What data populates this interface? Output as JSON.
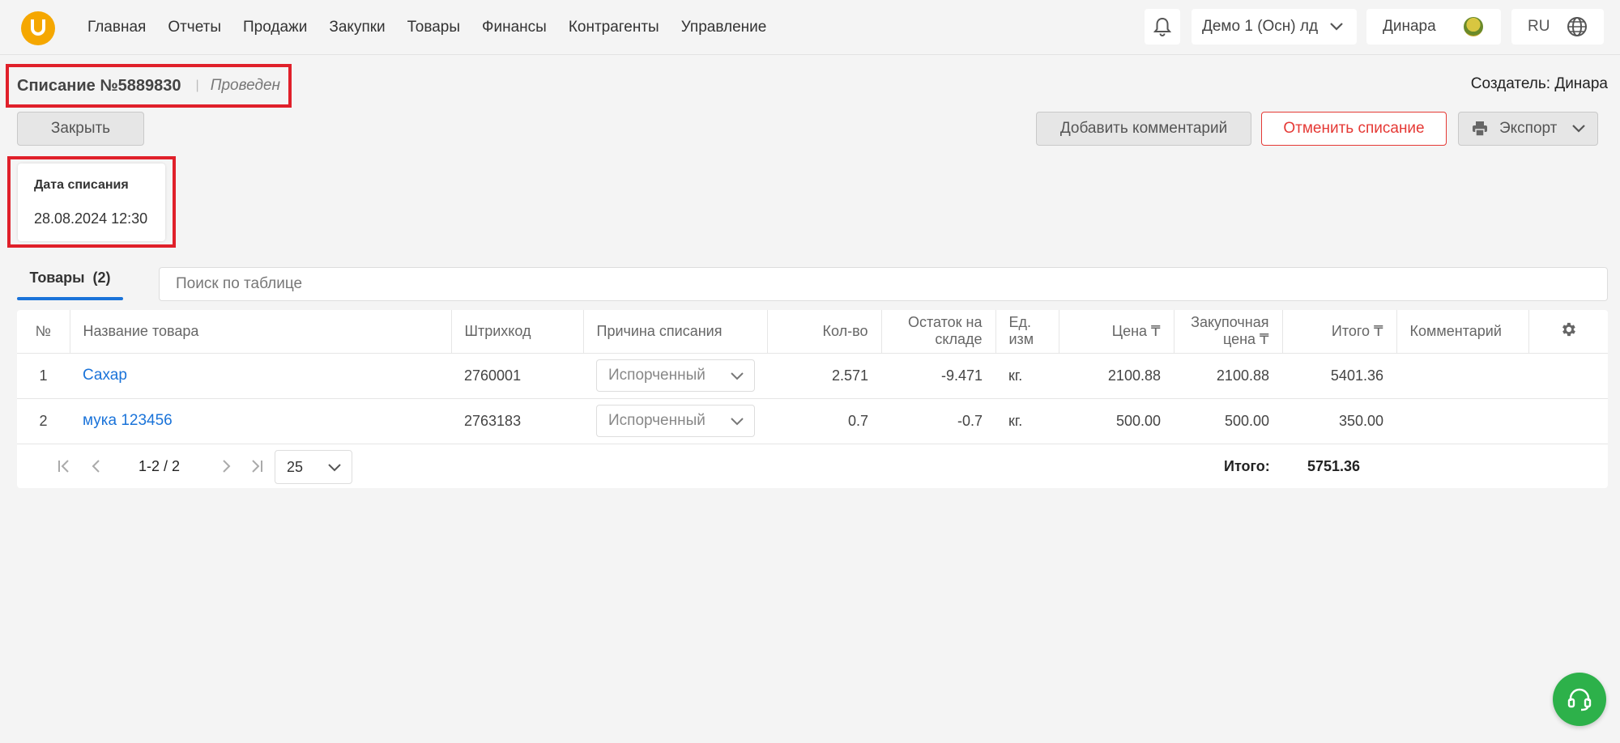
{
  "nav": {
    "items": [
      "Главная",
      "Отчеты",
      "Продажи",
      "Закупки",
      "Товары",
      "Финансы",
      "Контрагенты",
      "Управление"
    ],
    "organization": "Демо 1 (Осн) лд",
    "user": "Динара",
    "language": "RU"
  },
  "document": {
    "title": "Списание №5889830",
    "status": "Проведен",
    "creator": "Создатель: Динара",
    "date_label": "Дата списания",
    "date_value": "28.08.2024 12:30"
  },
  "actions": {
    "close": "Закрыть",
    "add_comment": "Добавить комментарий",
    "cancel_writeoff": "Отменить списание",
    "export": "Экспорт"
  },
  "tabs": {
    "products_label": "Товары",
    "products_count": "(2)"
  },
  "search": {
    "placeholder": "Поиск по таблице"
  },
  "table": {
    "headers": {
      "no": "№",
      "name": "Название товара",
      "barcode": "Штрихкод",
      "reason": "Причина списания",
      "qty": "Кол-во",
      "stock": "Остаток на складе",
      "unit": "Ед. изм",
      "price": "Цена ₸",
      "purchase_price": "Закупочная цена ₸",
      "total": "Итого ₸",
      "comment": "Комментарий"
    },
    "rows": [
      {
        "no": "1",
        "name": "Сахар",
        "barcode": "2760001",
        "reason": "Испорченный",
        "qty": "2.571",
        "stock": "-9.471",
        "unit": "кг.",
        "price": "2100.88",
        "purchase_price": "2100.88",
        "total": "5401.36",
        "comment": ""
      },
      {
        "no": "2",
        "name": "мука 123456",
        "barcode": "2763183",
        "reason": "Испорченный",
        "qty": "0.7",
        "stock": "-0.7",
        "unit": "кг.",
        "price": "500.00",
        "purchase_price": "500.00",
        "total": "350.00",
        "comment": ""
      }
    ]
  },
  "pager": {
    "range": "1-2 / 2",
    "page_size": "25",
    "total_label": "Итого:",
    "total_value": "5751.36"
  },
  "colors": {
    "accent": "#1a73d9",
    "danger": "#e53935",
    "brand": "#f5a700",
    "support": "#2db14a",
    "highlight": "#e0202a"
  }
}
